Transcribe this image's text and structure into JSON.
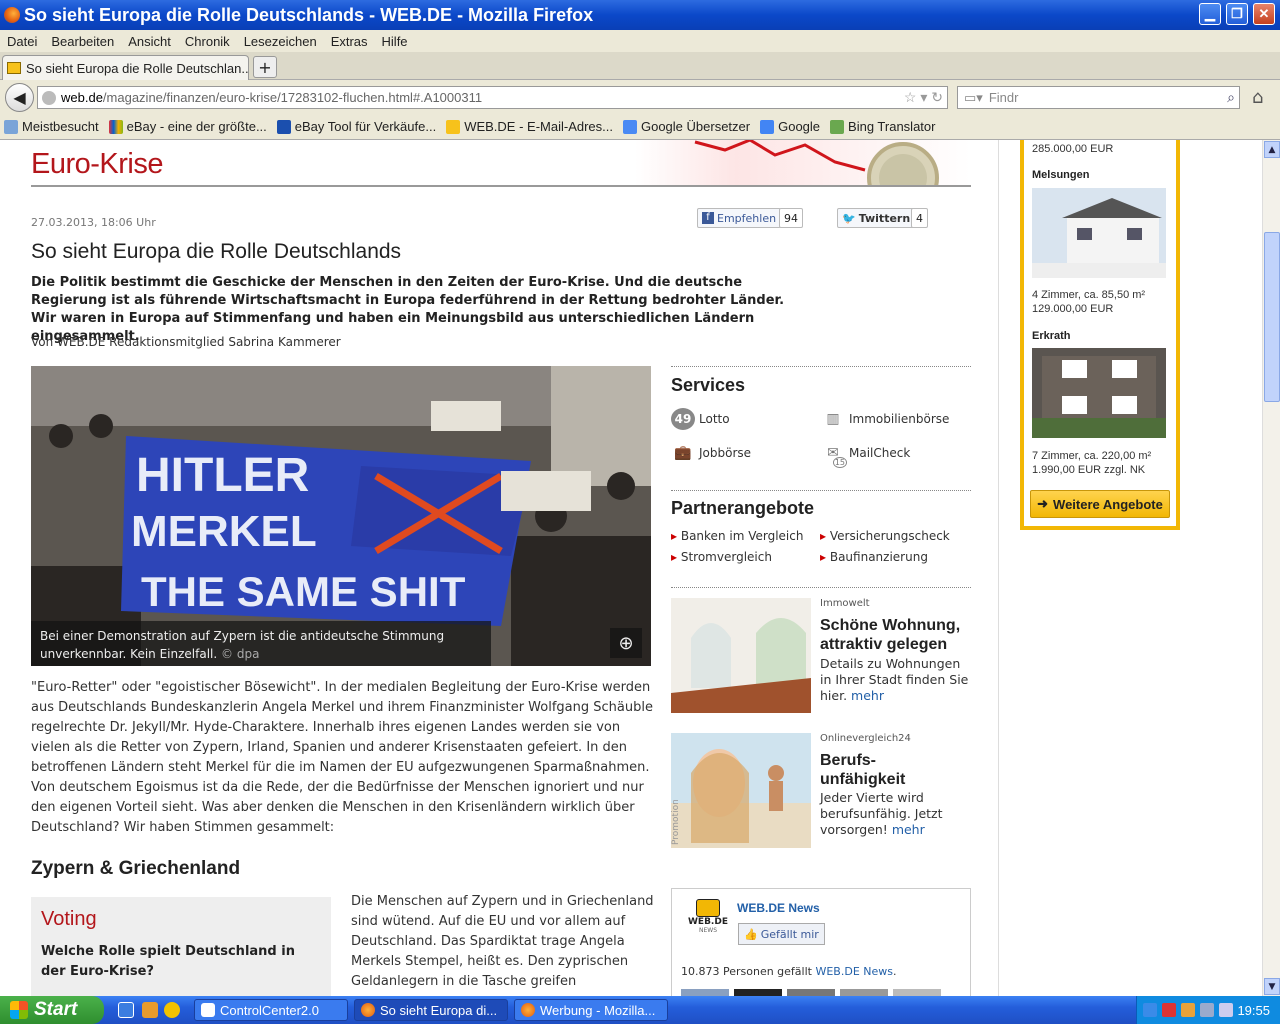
{
  "window": {
    "title": "So sieht Europa die Rolle Deutschlands - WEB.DE - Mozilla Firefox"
  },
  "menu": [
    "Datei",
    "Bearbeiten",
    "Ansicht",
    "Chronik",
    "Lesezeichen",
    "Extras",
    "Hilfe"
  ],
  "tab": {
    "label": "So sieht Europa die Rolle Deutschlan...",
    "new_tab": "+"
  },
  "nav": {
    "url_domain": "web.de",
    "url_path": "/magazine/finanzen/euro-krise/17283102-fluchen.html#.A1000311",
    "search_placeholder": "Findr"
  },
  "bookmarks": [
    "Meistbesucht",
    "eBay - eine der größte...",
    "eBay Tool für Verkäufe...",
    "WEB.DE - E-Mail-Adres...",
    "Google Übersetzer",
    "Google",
    "Bing Translator"
  ],
  "page": {
    "section_title": "Euro-Krise",
    "date": "27.03.2013, 18:06 Uhr",
    "facebook": {
      "label": "Empfehlen",
      "count": "94"
    },
    "twitter": {
      "label": "Twittern",
      "count": "4"
    },
    "title": "So sieht Europa die Rolle Deutschlands",
    "lead": "Die Politik bestimmt die Geschicke der Menschen in den Zeiten der Euro-Krise. Und die deutsche Regierung ist als führende Wirtschaftsmacht in Europa federführend in der Rettung bedrohter Länder. Wir waren in Europa auf Stimmenfang und haben ein Meinungsbild aus unterschiedlichen Ländern eingesammelt.",
    "author": "Von WEB.DE Redaktionsmitglied Sabrina Kammerer",
    "photo_banner": [
      "HITLER",
      "MERKEL",
      "THE SAME SHIT"
    ],
    "caption": "Bei einer Demonstration auf Zypern ist die antideutsche Stimmung unverkennbar. Kein Einzelfall.",
    "caption_credit": "© dpa",
    "body1": "\"Euro-Retter\" oder \"egoistischer Bösewicht\". In der medialen Begleitung der Euro-Krise werden aus Deutschlands Bundeskanzlerin Angela Merkel und ihrem Finanzminister Wolfgang Schäuble regelrechte Dr. Jekyll/Mr. Hyde-Charaktere. Innerhalb ihres eigenen Landes werden sie von vielen als die Retter von Zypern, Irland, Spanien und anderer Krisenstaaten gefeiert. In den betroffenen Ländern steht Merkel für die im Namen der EU aufgezwungenen Sparmaßnahmen. Von deutschem Egoismus ist da die Rede, der die Bedürfnisse der Menschen ignoriert und nur den eigenen Vorteil sieht. Was aber denken die Menschen in den Krisenländern wirklich über Deutschland? Wir haben Stimmen gesammelt:",
    "section_heading": "Zypern & Griechenland",
    "voting": {
      "title": "Voting",
      "question": "Welche Rolle spielt Deutschland in der Euro-Krise?"
    },
    "body2": "Die Menschen auf Zypern und in Griechenland sind wütend. Auf die EU und vor allem auf Deutschland. Das Spardiktat trage Angela Merkels Stempel, heißt es. Den zyprischen Geldanlegern in die Tasche greifen"
  },
  "services": {
    "title": "Services",
    "items": [
      {
        "label": "Lotto",
        "badge": "49"
      },
      {
        "label": "Immobilienbörse"
      },
      {
        "label": "Jobbörse"
      },
      {
        "label": "MailCheck",
        "badge": "15"
      }
    ]
  },
  "partner": {
    "title": "Partnerangebote",
    "items": [
      "Banken im Vergleich",
      "Versicherungscheck",
      "Stromvergleich",
      "Baufinanzierung"
    ]
  },
  "promos": [
    {
      "source": "Immowelt",
      "title": "Schöne Wohnung, attraktiv gelegen",
      "text": "Details zu Wohnungen in Ihrer Stadt finden Sie hier.",
      "more": "mehr"
    },
    {
      "source": "Onlinevergleich24",
      "title": "Berufs-unfähigkeit",
      "text": "Jeder Vierte wird berufsunfähig. Jetzt vorsorgen!",
      "more": "mehr",
      "tag": "Promotion"
    }
  ],
  "fb_box": {
    "name": "WEB.DE News",
    "like": "Gefällt mir",
    "logo": "WEB.DE",
    "logo_sub": "NEWS",
    "count_text": "10.873 Personen gefällt",
    "count_link": "WEB.DE News",
    "count_end": "."
  },
  "rail": {
    "top_price": "285.000,00 EUR",
    "listing1": {
      "city": "Melsungen",
      "details": "4 Zimmer, ca. 85,50 m²",
      "price": "129.000,00 EUR"
    },
    "listing2": {
      "city": "Erkrath",
      "details": "7 Zimmer, ca. 220,00 m²",
      "price": "1.990,00 EUR zzgl. NK"
    },
    "button": "Weitere Angebote"
  },
  "taskbar": {
    "start": "Start",
    "tasks": [
      "ControlCenter2.0",
      "So sieht Europa di...",
      "Werbung - Mozilla..."
    ],
    "clock": "19:55"
  },
  "colors": {
    "accent_red": "#b3161b",
    "rail_yellow": "#f2b705",
    "link_blue": "#2360a8"
  }
}
